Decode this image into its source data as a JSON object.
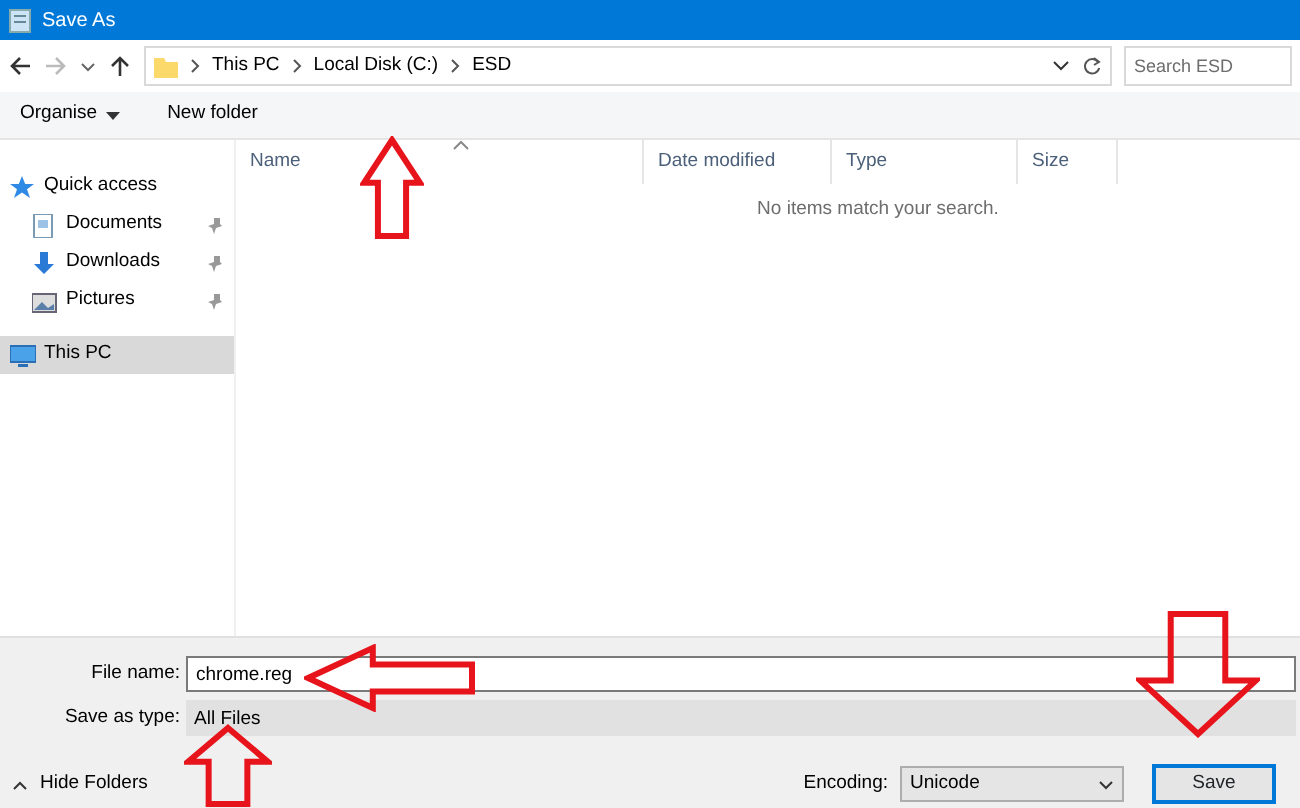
{
  "window": {
    "title": "Save As"
  },
  "address": {
    "breadcrumb": [
      "This PC",
      "Local Disk (C:)",
      "ESD"
    ],
    "search_placeholder": "Search ESD"
  },
  "toolbar": [
    {
      "label": "Organise",
      "dropdown": true
    },
    {
      "label": "New folder",
      "dropdown": false
    }
  ],
  "sidebar": [
    {
      "label": "Quick access",
      "kind": "star",
      "selected": false,
      "children": [
        {
          "label": "Documents",
          "kind": "document",
          "pinned": true,
          "selected": false
        },
        {
          "label": "Downloads",
          "kind": "download",
          "pinned": true,
          "selected": false
        },
        {
          "label": "Pictures",
          "kind": "pictures",
          "pinned": true,
          "selected": false
        }
      ]
    },
    {
      "label": "This PC",
      "kind": "computer",
      "selected": true
    }
  ],
  "table": {
    "columns": [
      "Name",
      "Date modified",
      "Type",
      "Size"
    ],
    "empty_message": "No items match your search."
  },
  "form": {
    "file_name_label": "File name:",
    "file_name": "chrome.reg",
    "type_label": "Save as type:",
    "type": "All Files",
    "hide_folders": "Hide Folders",
    "encoding_label": "Encoding:",
    "encoding": "Unicode",
    "save": "Save"
  }
}
